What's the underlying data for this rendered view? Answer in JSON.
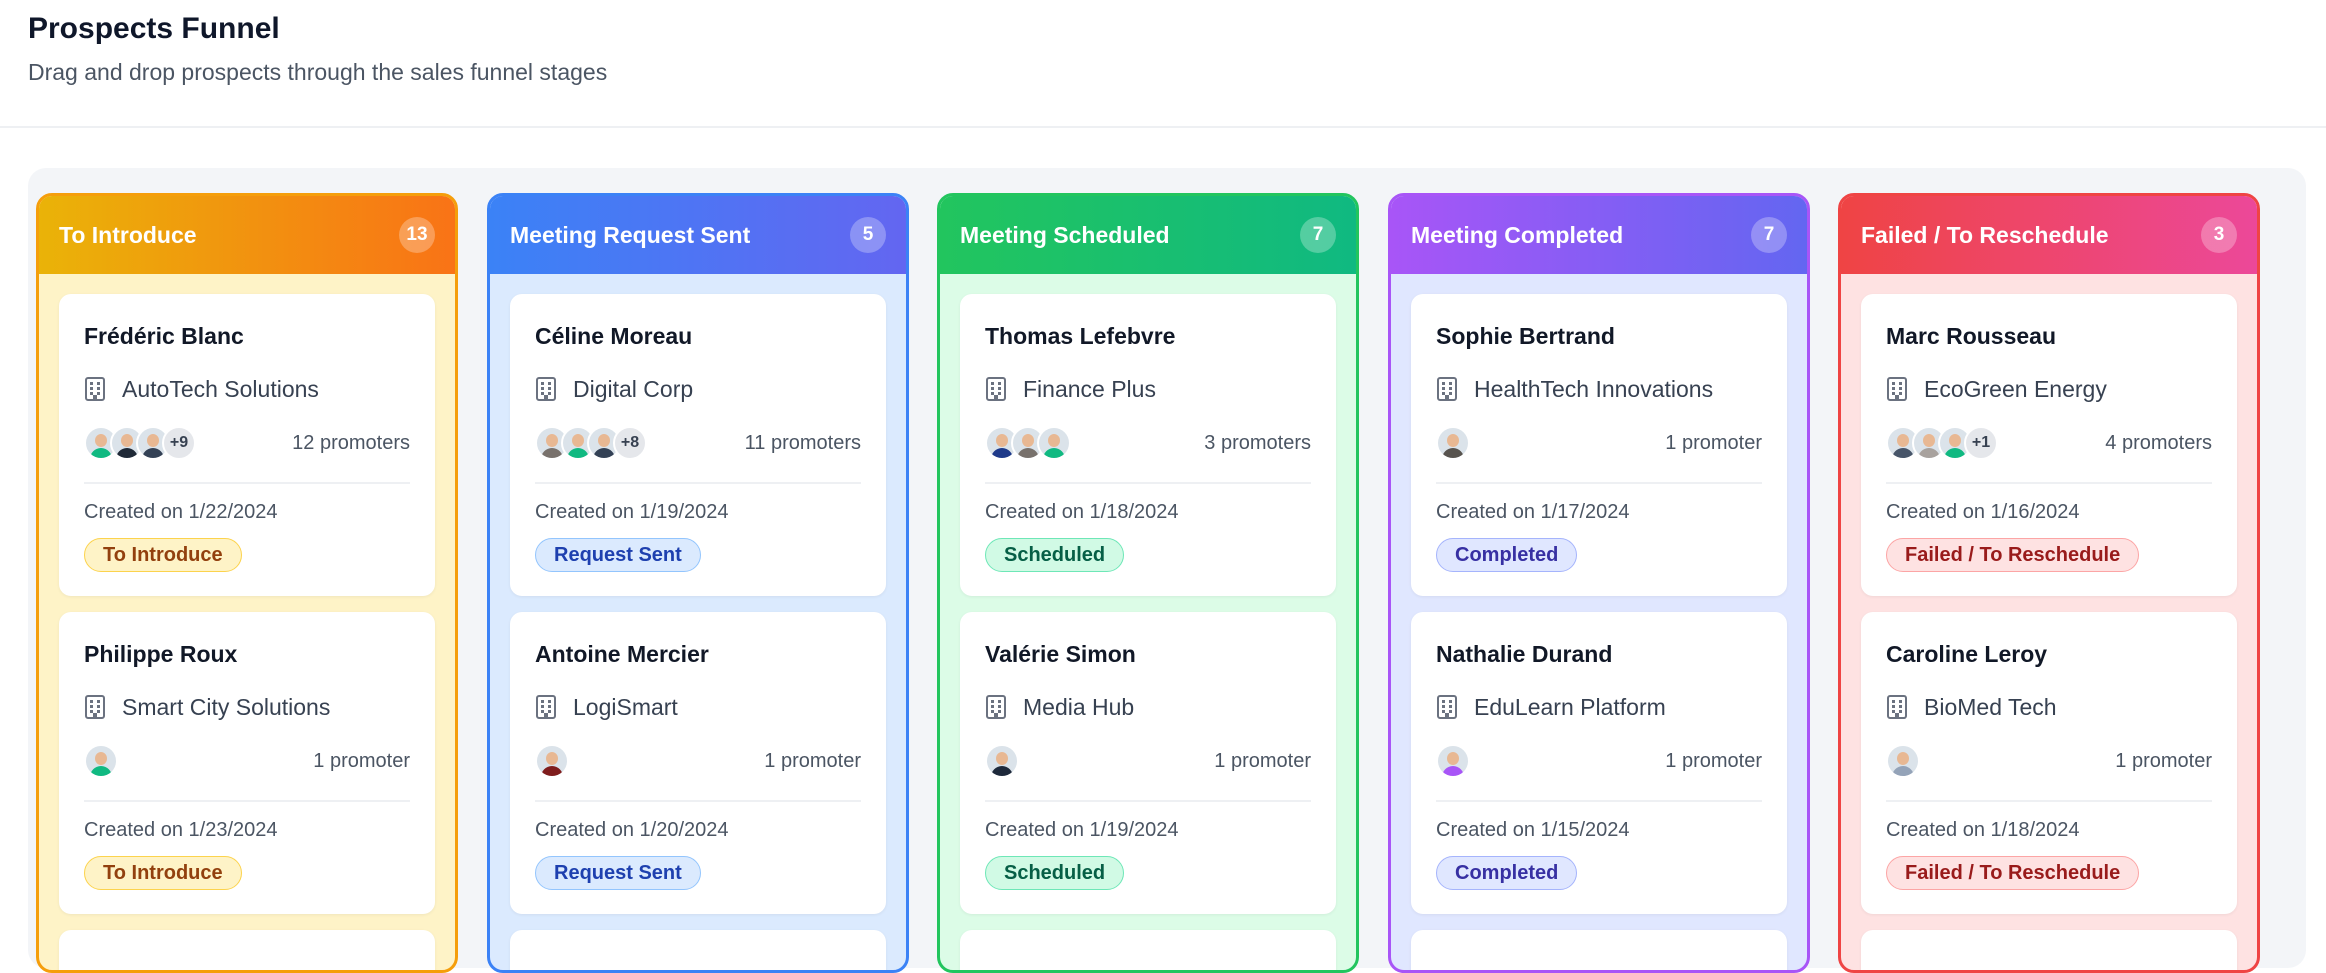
{
  "page": {
    "title": "Prospects Funnel",
    "subtitle": "Drag and drop prospects through the sales funnel stages"
  },
  "columns": [
    {
      "title": "To Introduce",
      "count": "13",
      "colors": {
        "head_from": "#eab308",
        "head_to": "#f97316",
        "border": "#f59e0b",
        "bg": "#fef3c7",
        "badge_bg": "#fef3c7",
        "badge_border": "#fcd34d",
        "badge_text": "#92400e"
      },
      "cards": [
        {
          "name": "Frédéric Blanc",
          "company": "AutoTech Solutions",
          "avatars": [
            "#10b981",
            "#1f2937",
            "#334155"
          ],
          "more": "+9",
          "promoters": "12 promoters",
          "created": "Created on 1/22/2024",
          "status": "To Introduce"
        },
        {
          "name": "Philippe Roux",
          "company": "Smart City Solutions",
          "avatars": [
            "#10b981"
          ],
          "more": "",
          "promoters": "1 promoter",
          "created": "Created on 1/23/2024",
          "status": "To Introduce"
        }
      ]
    },
    {
      "title": "Meeting Request Sent",
      "count": "5",
      "colors": {
        "head_from": "#3b82f6",
        "head_to": "#6366f1",
        "border": "#3b82f6",
        "bg": "#dbeafe",
        "badge_bg": "#dbeafe",
        "badge_border": "#93c5fd",
        "badge_text": "#1e40af"
      },
      "cards": [
        {
          "name": "Céline Moreau",
          "company": "Digital Corp",
          "avatars": [
            "#78716c",
            "#10b981",
            "#334155"
          ],
          "more": "+8",
          "promoters": "11 promoters",
          "created": "Created on 1/19/2024",
          "status": "Request Sent"
        },
        {
          "name": "Antoine Mercier",
          "company": "LogiSmart",
          "avatars": [
            "#7f1d1d"
          ],
          "more": "",
          "promoters": "1 promoter",
          "created": "Created on 1/20/2024",
          "status": "Request Sent"
        }
      ]
    },
    {
      "title": "Meeting Scheduled",
      "count": "7",
      "colors": {
        "head_from": "#22c55e",
        "head_to": "#10b981",
        "border": "#22c55e",
        "bg": "#dcfce7",
        "badge_bg": "#d1fae5",
        "badge_border": "#6ee7b7",
        "badge_text": "#065f46"
      },
      "cards": [
        {
          "name": "Thomas Lefebvre",
          "company": "Finance Plus",
          "avatars": [
            "#1e3a8a",
            "#78716c",
            "#10b981"
          ],
          "more": "",
          "promoters": "3 promoters",
          "created": "Created on 1/18/2024",
          "status": "Scheduled"
        },
        {
          "name": "Valérie Simon",
          "company": "Media Hub",
          "avatars": [
            "#1e293b"
          ],
          "more": "",
          "promoters": "1 promoter",
          "created": "Created on 1/19/2024",
          "status": "Scheduled"
        }
      ]
    },
    {
      "title": "Meeting Completed",
      "count": "7",
      "colors": {
        "head_from": "#a855f7",
        "head_to": "#6366f1",
        "border": "#a855f7",
        "bg": "#e0e7ff",
        "badge_bg": "#e0e7ff",
        "badge_border": "#a5b4fc",
        "badge_text": "#3730a3"
      },
      "cards": [
        {
          "name": "Sophie Bertrand",
          "company": "HealthTech Innovations",
          "avatars": [
            "#57534e"
          ],
          "more": "",
          "promoters": "1 promoter",
          "created": "Created on 1/17/2024",
          "status": "Completed"
        },
        {
          "name": "Nathalie Durand",
          "company": "EduLearn Platform",
          "avatars": [
            "#a855f7"
          ],
          "more": "",
          "promoters": "1 promoter",
          "created": "Created on 1/15/2024",
          "status": "Completed"
        }
      ]
    },
    {
      "title": "Failed / To Reschedule",
      "count": "3",
      "colors": {
        "head_from": "#ef4444",
        "head_to": "#ec4899",
        "border": "#ef4444",
        "bg": "#fee2e2",
        "badge_bg": "#fee2e2",
        "badge_border": "#fca5a5",
        "badge_text": "#991b1b"
      },
      "cards": [
        {
          "name": "Marc Rousseau",
          "company": "EcoGreen Energy",
          "avatars": [
            "#475569",
            "#a8a29e",
            "#10b981"
          ],
          "more": "+1",
          "promoters": "4 promoters",
          "created": "Created on 1/16/2024",
          "status": "Failed / To Reschedule"
        },
        {
          "name": "Caroline Leroy",
          "company": "BioMed Tech",
          "avatars": [
            "#94a3b8"
          ],
          "more": "",
          "promoters": "1 promoter",
          "created": "Created on 1/18/2024",
          "status": "Failed / To Reschedule"
        }
      ]
    }
  ]
}
